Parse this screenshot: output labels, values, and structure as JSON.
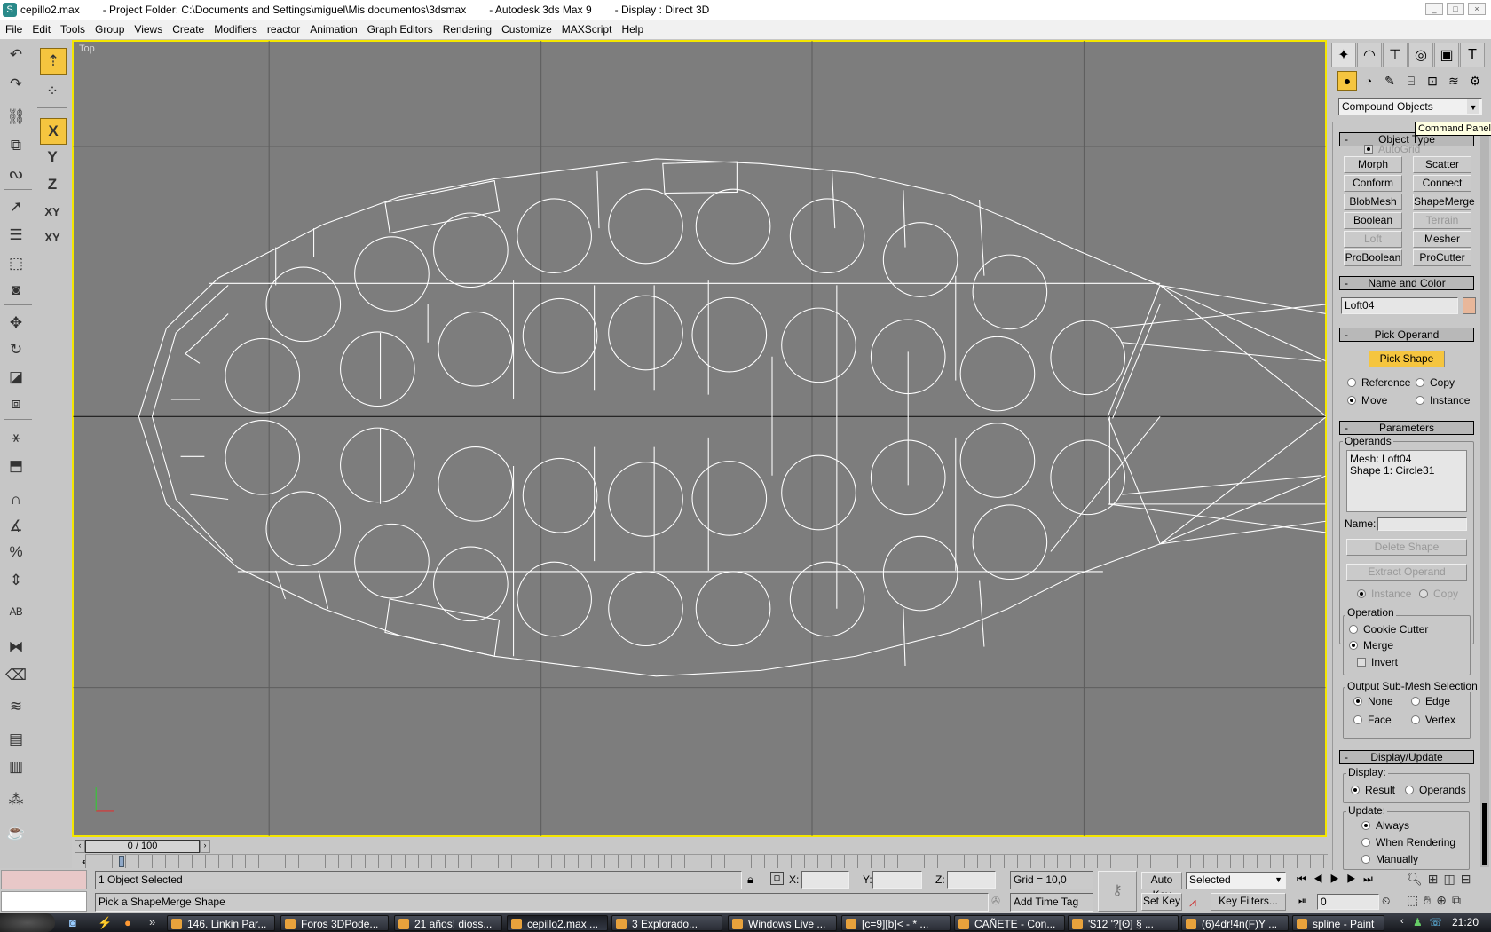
{
  "window": {
    "file": "cepillo2.max",
    "project": "- Project Folder: C:\\Documents and Settings\\miguel\\Mis documentos\\3dsmax",
    "app": "- Autodesk 3ds Max 9",
    "display": "- Display : Direct 3D"
  },
  "menu": [
    "File",
    "Edit",
    "Tools",
    "Group",
    "Views",
    "Create",
    "Modifiers",
    "reactor",
    "Animation",
    "Graph Editors",
    "Rendering",
    "Customize",
    "MAXScript",
    "Help"
  ],
  "viewport": {
    "label": "Top",
    "background": "#7d7d7d",
    "border": "#f4e600",
    "wire_color": "#ffffff"
  },
  "axis_constraints": [
    "X",
    "Y",
    "Z",
    "XY",
    "XY"
  ],
  "panel": {
    "tabs": [
      "create-icon",
      "modify-icon",
      "hierarchy-icon",
      "motion-icon",
      "display-icon",
      "utilities-icon"
    ],
    "category": "Compound Objects",
    "tooltip": "Command Panel",
    "object_type": {
      "header": "Object Type",
      "autogrid": "AutoGrid",
      "buttons": [
        "Morph",
        "Scatter",
        "Conform",
        "Connect",
        "BlobMesh",
        "ShapeMerge",
        "Boolean",
        "Terrain",
        "Loft",
        "Mesher",
        "ProBoolean",
        "ProCutter"
      ]
    },
    "name_color": {
      "header": "Name and Color",
      "name": "Loft04",
      "color": "#e8b79a"
    },
    "pick_operand": {
      "header": "Pick Operand",
      "pick_shape": "Pick Shape",
      "reference": "Reference",
      "copy": "Copy",
      "move": "Move",
      "instance": "Instance"
    },
    "parameters": {
      "header": "Parameters",
      "operands_label": "Operands",
      "operands": [
        "Mesh: Loft04",
        "Shape 1: Circle31"
      ],
      "name_label": "Name:",
      "name_value": "",
      "delete_shape": "Delete Shape",
      "extract_operand": "Extract Operand",
      "instance": "Instance",
      "copy": "Copy",
      "operation_label": "Operation",
      "cookie_cutter": "Cookie Cutter",
      "merge": "Merge",
      "invert": "Invert",
      "submesh_label": "Output Sub-Mesh Selection",
      "none": "None",
      "edge": "Edge",
      "face": "Face",
      "vertex": "Vertex"
    },
    "display_update": {
      "header": "Display/Update",
      "display_label": "Display:",
      "result": "Result",
      "operands": "Operands",
      "update_label": "Update:",
      "always": "Always",
      "when_rendering": "When Rendering",
      "manually": "Manually"
    }
  },
  "timeline": {
    "slider": "0 / 100"
  },
  "status": {
    "selection": "1 Object Selected",
    "prompt": "Pick a ShapeMerge Shape",
    "x_label": "X:",
    "y_label": "Y:",
    "z_label": "Z:",
    "x": "",
    "y": "",
    "z": "",
    "grid": "Grid = 10,0",
    "add_time_tag": "Add Time Tag",
    "auto_key": "Auto Key",
    "set_key": "Set Key",
    "key_mode": "Selected",
    "key_filters": "Key Filters...",
    "frame": "0"
  },
  "taskbar": {
    "items": [
      "146. Linkin Par...",
      "Foros 3DPode...",
      "21 años! dioss...",
      "cepillo2.max  ...",
      "3 Explorado...",
      "Windows Live ...",
      "[c=9][b]< - * ...",
      "CAÑETE - Con...",
      "'$12 '?[ʘ] § ...",
      "(6)4dr!4n(F)Y ...",
      "spline - Paint"
    ],
    "active": "cepillo2.max  ...",
    "clock": "21:20"
  }
}
